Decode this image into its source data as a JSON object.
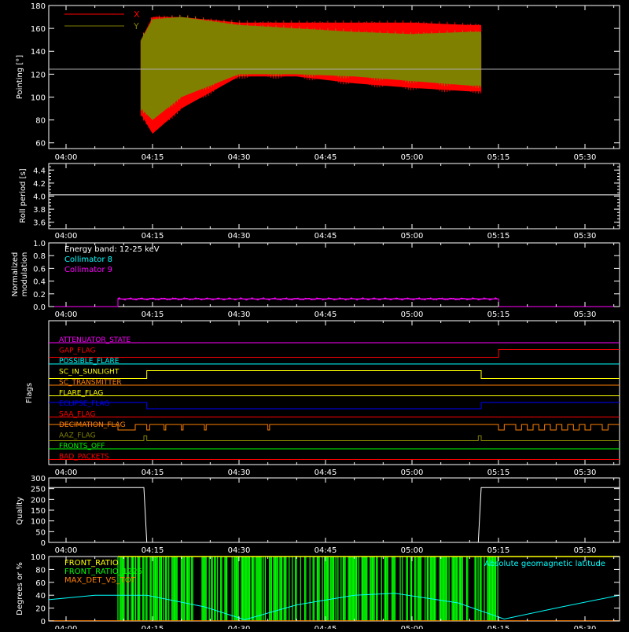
{
  "colors": {
    "background": "#000000",
    "axes": "#ffffff",
    "x_pointing": "#ff0000",
    "y_pointing": "#808000",
    "collimator8": "#00ffff",
    "collimator9": "#ff00ff",
    "front_ratio": "#ffff00",
    "front_ratio_1225": "#00ff00",
    "max_det_vs_tot": "#ff8000",
    "geomag": "#00ffff"
  },
  "time_axis": {
    "ticks": [
      "04:00",
      "04:15",
      "04:30",
      "04:45",
      "05:00",
      "05:15",
      "05:30"
    ],
    "tick_minutes": [
      0,
      15,
      30,
      45,
      60,
      75,
      90
    ],
    "range_minutes": [
      -3,
      96
    ]
  },
  "panels": {
    "pointing": {
      "ylabel": "Pointing [°]",
      "yticks": [
        "60",
        "80",
        "100",
        "120",
        "140",
        "160",
        "180"
      ],
      "legend": [
        {
          "label": "X",
          "color": "#ff0000"
        },
        {
          "label": "Y",
          "color": "#808000"
        }
      ]
    },
    "roll": {
      "ylabel": "Roll period [s]",
      "yticks": [
        "3.6",
        "3.8",
        "4.0",
        "4.2",
        "4.4"
      ]
    },
    "modulation": {
      "ylabel_line1": "Normalized",
      "ylabel_line2": "modulation",
      "yticks": [
        "0.0",
        "0.2",
        "0.4",
        "0.6",
        "0.8",
        "1.0"
      ],
      "legend_energy": "Energy band: 12-25 keV",
      "legend_c8": "Collimator 8",
      "legend_c9": "Collimator 9"
    },
    "flags": {
      "ylabel": "Flags",
      "items": [
        {
          "label": "ATTENUATOR_STATE",
          "color": "#ff00ff"
        },
        {
          "label": "GAP_FLAG",
          "color": "#ff0000"
        },
        {
          "label": "POSSIBLE_FLARE",
          "color": "#00ffff"
        },
        {
          "label": "SC_IN_SUNLIGHT",
          "color": "#ffff00"
        },
        {
          "label": "SC_TRANSMITTER",
          "color": "#ff8000"
        },
        {
          "label": "FLARE_FLAG",
          "color": "#ffff00"
        },
        {
          "label": "ECLIPSE_FLAG",
          "color": "#0000ff"
        },
        {
          "label": "SAA_FLAG",
          "color": "#ff0000"
        },
        {
          "label": "DECIMATION_FLAG",
          "color": "#ff8000"
        },
        {
          "label": "AAZ_FLAG",
          "color": "#808000"
        },
        {
          "label": "FRONTS_OFF",
          "color": "#00ff00"
        },
        {
          "label": "BAD_PACKETS",
          "color": "#ff0000"
        }
      ]
    },
    "quality": {
      "ylabel": "Quality",
      "yticks": [
        "0",
        "50",
        "100",
        "150",
        "200",
        "250",
        "300"
      ]
    },
    "ratios": {
      "ylabel": "Degrees or %",
      "yticks": [
        "0",
        "20",
        "40",
        "60",
        "80",
        "100"
      ],
      "legend_front": "FRONT_RATIO",
      "legend_front1225": "FRONT_RATIO_1225",
      "legend_maxdet": "MAX_DET_VS_TOT",
      "legend_geomag": "Absolute geomagnetic latitude"
    }
  },
  "chart_data": [
    {
      "type": "line",
      "panel": "pointing",
      "ylabel": "Pointing [°]",
      "xlim_minutes": [
        -3,
        96
      ],
      "ylim": [
        55,
        180
      ],
      "reference_line_y": 128,
      "series": [
        {
          "name": "X",
          "x_minutes": [
            13,
            15,
            20,
            30,
            40,
            50,
            60,
            70,
            72
          ],
          "y_max": [
            150,
            170,
            170,
            165,
            165,
            165,
            165,
            163,
            163
          ],
          "y_min": [
            85,
            68,
            90,
            118,
            118,
            112,
            108,
            105,
            105
          ]
        },
        {
          "name": "Y",
          "x_minutes": [
            13,
            15,
            20,
            30,
            40,
            50,
            60,
            70,
            72
          ],
          "y_max": [
            150,
            168,
            170,
            163,
            160,
            157,
            155,
            157,
            157
          ],
          "y_min": [
            90,
            80,
            100,
            120,
            120,
            118,
            114,
            110,
            110
          ]
        }
      ]
    },
    {
      "type": "line",
      "panel": "roll",
      "ylabel": "Roll period [s]",
      "ylim": [
        3.5,
        4.5
      ],
      "series": [
        {
          "x_minutes": [
            -3,
            96
          ],
          "y": [
            4.02,
            4.02
          ]
        }
      ]
    },
    {
      "type": "line",
      "panel": "modulation",
      "ylim": [
        0,
        1
      ],
      "series": [
        {
          "name": "Collimator 9",
          "x_minutes": [
            -3,
            9,
            9,
            75,
            75,
            96
          ],
          "y": [
            0,
            0,
            0.12,
            0.12,
            0,
            0
          ]
        }
      ]
    },
    {
      "type": "line",
      "panel": "quality",
      "ylabel": "Quality",
      "ylim": [
        0,
        300
      ],
      "series": [
        {
          "x_minutes": [
            -3,
            13.5,
            14,
            71.5,
            72,
            96
          ],
          "y": [
            255,
            255,
            0,
            0,
            255,
            255
          ]
        }
      ]
    },
    {
      "type": "line",
      "panel": "ratios",
      "ylabel": "Degrees or %",
      "ylim": [
        0,
        100
      ],
      "series": [
        {
          "name": "Absolute geomagnetic latitude",
          "x_minutes": [
            -3,
            5,
            14,
            24,
            31,
            40,
            50,
            57,
            68,
            76,
            86,
            96
          ],
          "y": [
            33,
            40,
            40,
            22,
            2,
            25,
            40,
            43,
            28,
            3,
            22,
            40
          ]
        }
      ]
    }
  ]
}
